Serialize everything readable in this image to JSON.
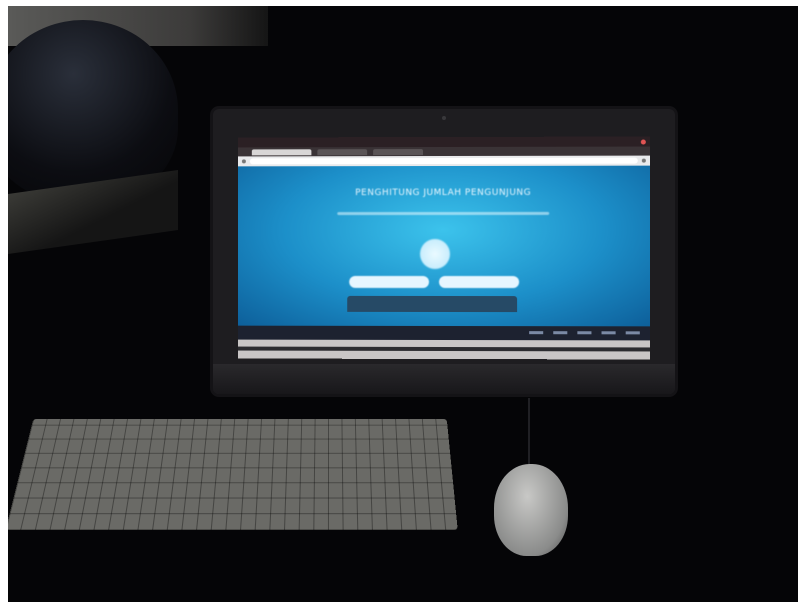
{
  "scene": {
    "objects": [
      "monitor",
      "keyboard",
      "mouse",
      "helmet"
    ],
    "monitor_screen": {
      "page_title": "PENGHITUNG JUMLAH PENGUNJUNG"
    }
  },
  "colors": {
    "screen_accent": "#1c8fc9",
    "background": "#050507"
  }
}
